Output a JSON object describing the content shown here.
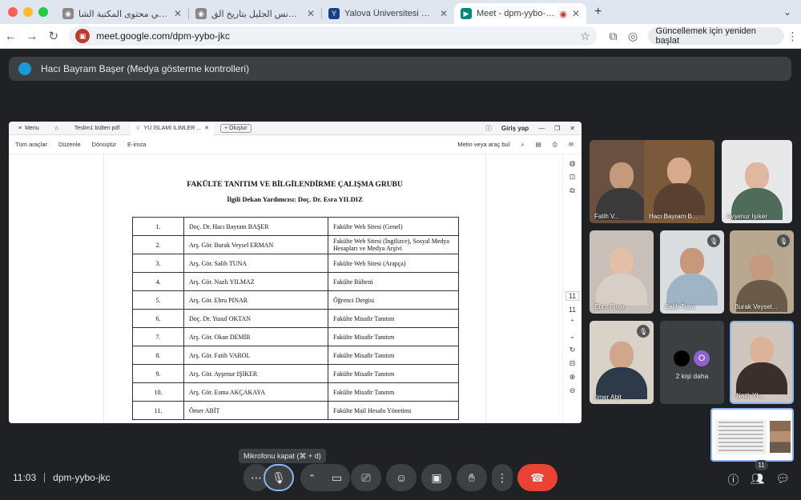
{
  "browser": {
    "tabs": [
      {
        "title": "بحث متقدم في محتوى المكتبة الشا",
        "icon_color": "#5f6368"
      },
      {
        "title": "ص3 - كتاب الأنس الجليل بتاريخ الق",
        "icon_color": "#5f6368"
      },
      {
        "title": "Yalova Üniversitesi Uzaktan E",
        "icon_color": "#1a3f8b"
      },
      {
        "title": "Meet - dpm-yybo-jkc",
        "icon_color": "#00897b"
      }
    ],
    "url": "meet.google.com/dpm-yybo-jkc",
    "update_label": "Güncellemek için yeniden başlat"
  },
  "presentation": {
    "banner": "Hacı Bayram Başer (Medya gösterme kontrolleri)"
  },
  "pdf": {
    "tabs": {
      "menu": "Menu",
      "file": "Teslim1 bülten pdf",
      "active": "YU İSLAMİ İLİMLER ...",
      "create": "Oluştur",
      "login": "Giriş yap"
    },
    "tools": {
      "all": "Tüm araçlar",
      "edit": "Düzenle",
      "convert": "Dönüştür",
      "esign": "E-imza",
      "search": "Metin veya araç bul"
    },
    "title": "FAKÜLTE TANITIM VE BİLGİLENDİRME ÇALIŞMA GRUBU",
    "subtitle": "İlgili Dekan Yardımcısı: Doç. Dr. Esra YILDIZ",
    "rows": [
      {
        "n": "1.",
        "name": "Doç. Dr. Hacı Bayram BAŞER",
        "task": "Fakülte Web Sitesi (Genel)"
      },
      {
        "n": "2.",
        "name": "Arş. Gör. Burak Veysel ERMAN",
        "task": "Fakülte Web Sitesi (İngilizce), Sosyal Medya Hesapları ve Medya Arşivi"
      },
      {
        "n": "3.",
        "name": "Arş. Gör. Salih TUNA",
        "task": "Fakülte Web Sitesi (Arapça)"
      },
      {
        "n": "4.",
        "name": "Arş. Gör. Nazlı YILMAZ",
        "task": "Fakülte Bülteni"
      },
      {
        "n": "5.",
        "name": "Arş. Gör. Ebru PINAR",
        "task": "Öğrenci Dergisi"
      },
      {
        "n": "6.",
        "name": "Doç. Dr. Yusuf OKTAN",
        "task": "Fakülte Misafir Tanıtım"
      },
      {
        "n": "7.",
        "name": "Arş. Gör. Okan DEMİR",
        "task": "Fakülte Misafir Tanıtım"
      },
      {
        "n": "8.",
        "name": "Arş. Gör. Fatih VAROL",
        "task": "Fakülte Misafir Tanıtım"
      },
      {
        "n": "9.",
        "name": "Arş. Gör. Ayşenur IŞIKER",
        "task": "Fakülte Misafir Tanıtım"
      },
      {
        "n": "10.",
        "name": "Arş. Gör. Esma AKÇAKAYA",
        "task": "Fakülte Misafir Tanıtım"
      },
      {
        "n": "11.",
        "name": "Ömer ABİT",
        "task": "Fakülte Mail Hesabı Yönetimi"
      }
    ],
    "page_num": "11"
  },
  "participants": [
    {
      "name": "Fatih V...",
      "muted": false,
      "bg": "#6a5040",
      "skin": "#c49a7a",
      "shirt": "#3a3a3a"
    },
    {
      "name": "Hacı Bayram B...",
      "muted": false,
      "bg": "#7b5a3c",
      "skin": "#d8a98a",
      "shirt": "#5a4030"
    },
    {
      "name": "Ayşenur Işıker",
      "muted": false,
      "bg": "#e8e8e8",
      "skin": "#e0b8a0",
      "shirt": "#4f6b5a"
    },
    {
      "name": "Ebru Pınar",
      "muted": false,
      "bg": "#c8c0b8",
      "skin": "#e3bfa5",
      "shirt": "#d7cfc7"
    },
    {
      "name": "Salih Tuna",
      "muted": true,
      "bg": "#d9dde0",
      "skin": "#c9987b",
      "shirt": "#9fb4c5"
    },
    {
      "name": "Burak Veysel...",
      "muted": true,
      "bg": "#b8a890",
      "skin": "#c59a80",
      "shirt": "#6a5a48"
    },
    {
      "name": "ömer Abit",
      "muted": true,
      "bg": "#d8d2c8",
      "skin": "#d0a68c",
      "shirt": "#2e3a4a"
    },
    {
      "name": "Nazlı YI...",
      "muted": false,
      "bg": "#cfc6be",
      "skin": "#dcb39a",
      "shirt": "#3a2f2a"
    }
  ],
  "more_people": {
    "label": "2 kişi daha",
    "avatar_letter": "O"
  },
  "self_count": "11",
  "tooltip": "Mikrofonu kapat (⌘ + d)",
  "meeting": {
    "time": "11:03",
    "code": "dpm-yybo-jkc"
  },
  "colors": {
    "accent": "#8ab4f8",
    "hangup": "#ea4335",
    "control": "#3c4043"
  }
}
